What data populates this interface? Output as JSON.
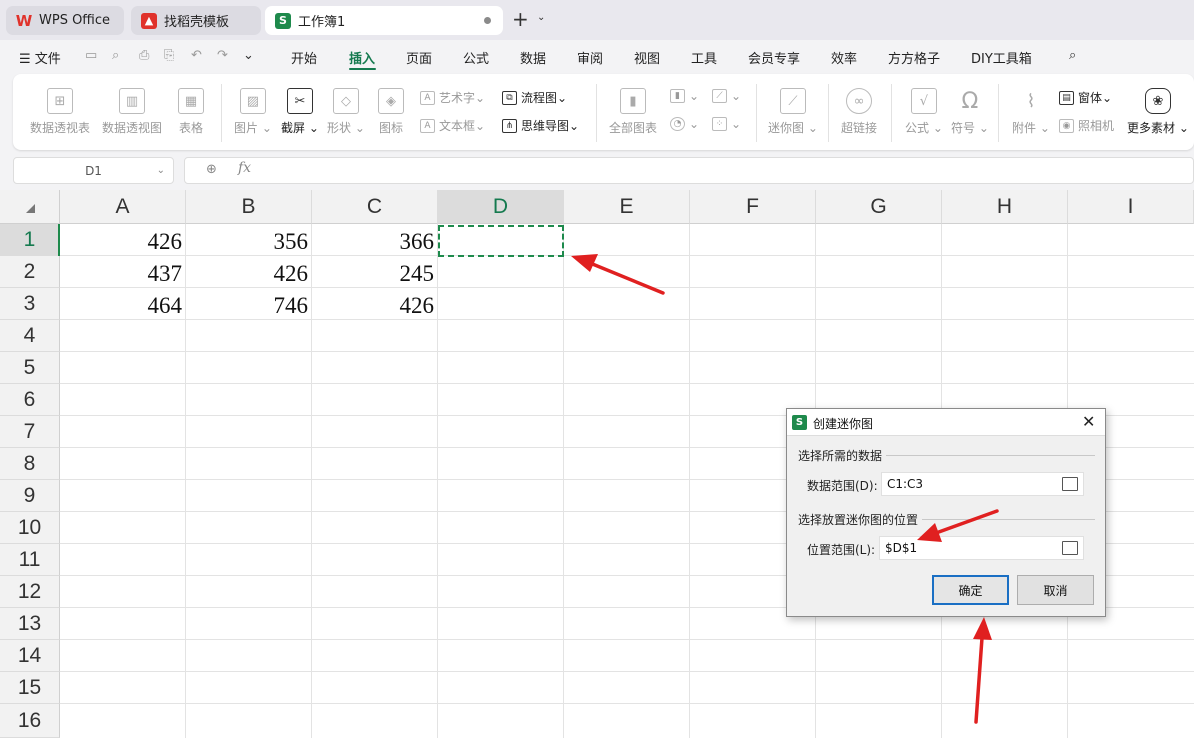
{
  "tabs": [
    {
      "label": "WPS Office",
      "icon": "wps-logo-icon",
      "color": "#e0322b"
    },
    {
      "label": "找稻壳模板",
      "icon": "docer-icon",
      "color": "#e0322b"
    },
    {
      "label": "工作簿1",
      "icon": "sheet-icon",
      "color": "#1e8a4c"
    }
  ],
  "menu": {
    "file": "文件",
    "items": [
      "开始",
      "插入",
      "页面",
      "公式",
      "数据",
      "审阅",
      "视图",
      "工具",
      "会员专享",
      "效率",
      "方方格子",
      "DIY工具箱"
    ],
    "active": "插入"
  },
  "ribbon": {
    "pivot_table": "数据透视表",
    "pivot_chart": "数据透视图",
    "table": "表格",
    "picture": "图片",
    "screenshot": "截屏",
    "shape": "形状",
    "icon": "图标",
    "art_text": "艺术字",
    "textbox": "文本框",
    "flowchart": "流程图",
    "mindmap": "思维导图",
    "all_charts": "全部图表",
    "sparkline": "迷你图",
    "hyperlink": "超链接",
    "formula": "公式",
    "symbol": "符号",
    "attachment": "附件",
    "camera": "照相机",
    "form": "窗体",
    "more": "更多素材"
  },
  "formula_bar": {
    "name_box": "D1",
    "value": ""
  },
  "sheet": {
    "columns": [
      "A",
      "B",
      "C",
      "D",
      "E",
      "F",
      "G",
      "H",
      "I"
    ],
    "rows": [
      "1",
      "2",
      "3",
      "4",
      "5",
      "6",
      "7",
      "8",
      "9",
      "10",
      "11",
      "12",
      "13",
      "14",
      "15",
      "16"
    ],
    "cells": [
      [
        "426",
        "356",
        "366"
      ],
      [
        "437",
        "426",
        "245"
      ],
      [
        "464",
        "746",
        "426"
      ]
    ]
  },
  "dialog": {
    "title": "创建迷你图",
    "section1": "选择所需的数据",
    "data_range_label": "数据范围(D):",
    "data_range_value": "C1:C3",
    "section2": "选择放置迷你图的位置",
    "location_label": "位置范围(L):",
    "location_value": "$D$1",
    "ok": "确定",
    "cancel": "取消"
  },
  "colors": {
    "accent": "#157a4f",
    "annotation": "#e02020"
  }
}
